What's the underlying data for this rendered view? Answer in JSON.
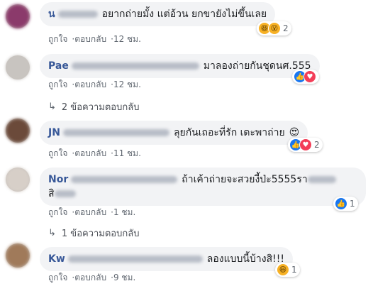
{
  "comments": [
    {
      "name": "น",
      "text": "อยากถ่ายมั้ง แต่อ้วน ยกขายังไม่ขึ้นเลย",
      "like": "ถูกใจ",
      "reply": "ตอบกลับ",
      "time": "12 ชม.",
      "reaction_count": "2",
      "reactions": [
        "haha-icon",
        "wow-icon"
      ],
      "avatar_color": "#8b3a6b"
    },
    {
      "name": "Pae",
      "text": "มาลองถ่ายกันชุดนศ.555",
      "like": "ถูกใจ",
      "reply": "ตอบกลับ",
      "time": "12 ชม.",
      "reaction_count": "",
      "reactions": [
        "like-icon",
        "love-icon"
      ],
      "replies_label": "2 ข้อความตอบกลับ",
      "avatar_color": "#c8c4c0"
    },
    {
      "name": "JN",
      "text": "ลุยกันเถอะที่รัก เดะพาถ่าย",
      "like": "ถูกใจ",
      "reply": "ตอบกลับ",
      "time": "11 ชม.",
      "reaction_count": "2",
      "reactions": [
        "like-icon",
        "love-icon"
      ],
      "avatar_color": "#6b4a3a"
    },
    {
      "name": "Nor",
      "text": "ถ้าเค้าถ่ายจะสวยงี้ป่ะ5555รา",
      "text_line2": "สิ",
      "like": "ถูกใจ",
      "reply": "ตอบกลับ",
      "time": "1 ชม.",
      "reaction_count": "1",
      "reactions": [
        "like-icon"
      ],
      "replies_label": "1 ข้อความตอบกลับ",
      "avatar_color": "#d7cfc8"
    },
    {
      "name": "Kw",
      "text": "ลองแบบนี้บ้างสิ!!!",
      "like": "ถูกใจ",
      "reply": "ตอบกลับ",
      "time": "9 ชม.",
      "reaction_count": "1",
      "reactions": [
        "haha-icon"
      ],
      "avatar_color": "#a07a5a"
    }
  ],
  "colors": {
    "name": "#385898",
    "bubble": "#f2f3f5",
    "meta": "#606770"
  }
}
